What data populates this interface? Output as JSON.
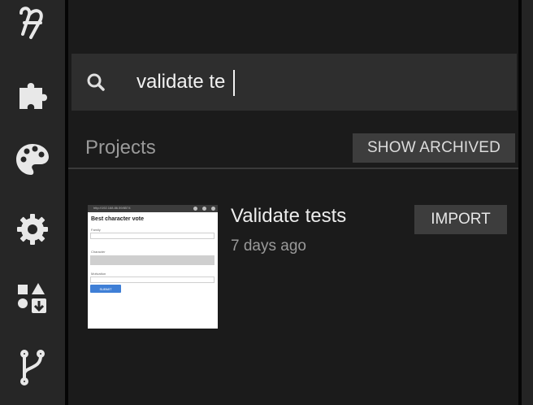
{
  "sidebar": {
    "items": [
      {
        "icon": "logo-icon"
      },
      {
        "icon": "puzzle-icon"
      },
      {
        "icon": "palette-icon"
      },
      {
        "icon": "gear-icon"
      },
      {
        "icon": "shapes-import-icon"
      },
      {
        "icon": "git-branch-icon"
      }
    ]
  },
  "search": {
    "value": "validate te",
    "icon": "search-icon"
  },
  "projects_section": {
    "title": "Projects",
    "show_archived_label": "SHOW ARCHIVED"
  },
  "projects": [
    {
      "name": "Validate tests",
      "modified": "7 days ago",
      "import_label": "IMPORT",
      "thumbnail": {
        "url": "http://192.168.86.59/8574",
        "heading": "Best character vote",
        "field1_label": "Family",
        "field2_label": "Character",
        "field3_label": "Motivation",
        "submit_label": "SUBMIT"
      }
    }
  ],
  "colors": {
    "background": "#1b1b1b",
    "sidebar": "#262626",
    "search_box": "#2e2e2e",
    "button": "#3d3d3d",
    "accent_blue": "#3f7fd6"
  }
}
